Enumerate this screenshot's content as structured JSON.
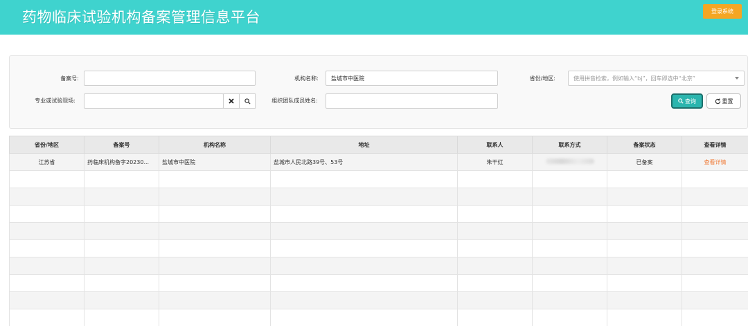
{
  "header": {
    "title": "药物临床试验机构备案管理信息平台",
    "login_label": "登录系统",
    "bg_color": "#3fd3ce",
    "login_color": "#f5a623"
  },
  "search": {
    "record_no_label": "备案号:",
    "record_no_value": "",
    "org_name_label": "机构名称:",
    "org_name_value": "盐城市中医院",
    "province_label": "省份/地区:",
    "province_placeholder": "使用拼音检索，例如输入“bj”，回车即选中“北京”",
    "specialty_label": "专业或试验现场:",
    "specialty_value": "",
    "team_member_label": "组织团队成员姓名:",
    "team_member_value": "",
    "query_label": "查询",
    "reset_label": "重置",
    "query_color": "#2bb5ae"
  },
  "table": {
    "columns": [
      "省份/地区",
      "备案号",
      "机构名称",
      "地址",
      "联系人",
      "联系方式",
      "备案状态",
      "查看详情"
    ],
    "rows": [
      {
        "province": "江苏省",
        "record_no": "药临床机构备字20230...",
        "org_name": "盐城市中医院",
        "address": "盐城市人民北路39号、53号",
        "contact": "朱干红",
        "phone": "",
        "status": "已备案",
        "detail": "查看详情"
      }
    ],
    "link_color": "#f07d3a"
  }
}
